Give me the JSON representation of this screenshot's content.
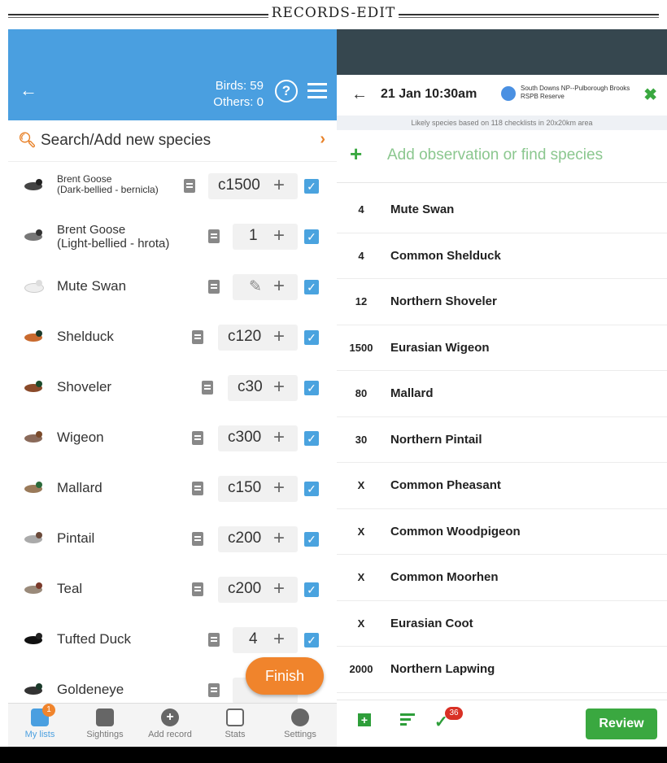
{
  "banner": {
    "label": "RECORDS-EDIT"
  },
  "left": {
    "header": {
      "birds": "Birds: 59",
      "others": "Others: 0"
    },
    "search": {
      "placeholder": "Search/Add new species"
    },
    "rows": [
      {
        "name": "Brent Goose\n(Dark-bellied - bernicla)",
        "count": "c1500"
      },
      {
        "name": "Brent Goose\n(Light-bellied - hrota)",
        "count": "1"
      },
      {
        "name": "Mute Swan",
        "count": ""
      },
      {
        "name": "Shelduck",
        "count": "c120"
      },
      {
        "name": "Shoveler",
        "count": "c30"
      },
      {
        "name": "Wigeon",
        "count": "c300"
      },
      {
        "name": "Mallard",
        "count": "c150"
      },
      {
        "name": "Pintail",
        "count": "c200"
      },
      {
        "name": "Teal",
        "count": "c200"
      },
      {
        "name": "Tufted Duck",
        "count": "4"
      },
      {
        "name": "Goldeneye",
        "count": ""
      }
    ],
    "finish": "Finish",
    "nav": [
      {
        "label": "My lists",
        "icon": "list-icon"
      },
      {
        "label": "Sightings",
        "icon": "map-icon"
      },
      {
        "label": "Add record",
        "icon": "plus-circle-icon"
      },
      {
        "label": "Stats",
        "icon": "stats-icon"
      },
      {
        "label": "Settings",
        "icon": "gear-icon"
      }
    ],
    "nav_badge": "1"
  },
  "right": {
    "header": {
      "datetime": "21 Jan 10:30am",
      "location": "South Downs NP--Pulborough Brooks RSPB Reserve"
    },
    "likely": "Likely species based on 118 checklists in 20x20km area",
    "add": "Add observation or find species",
    "observations": [
      {
        "count": "4",
        "species": "Mute Swan"
      },
      {
        "count": "4",
        "species": "Common Shelduck"
      },
      {
        "count": "12",
        "species": "Northern Shoveler"
      },
      {
        "count": "1500",
        "species": "Eurasian Wigeon"
      },
      {
        "count": "80",
        "species": "Mallard"
      },
      {
        "count": "30",
        "species": "Northern Pintail"
      },
      {
        "count": "X",
        "species": "Common Pheasant"
      },
      {
        "count": "X",
        "species": "Common Woodpigeon"
      },
      {
        "count": "X",
        "species": "Common Moorhen"
      },
      {
        "count": "X",
        "species": "Eurasian Coot"
      },
      {
        "count": "2000",
        "species": "Northern Lapwing"
      }
    ],
    "badge": "36",
    "review": "Review"
  }
}
